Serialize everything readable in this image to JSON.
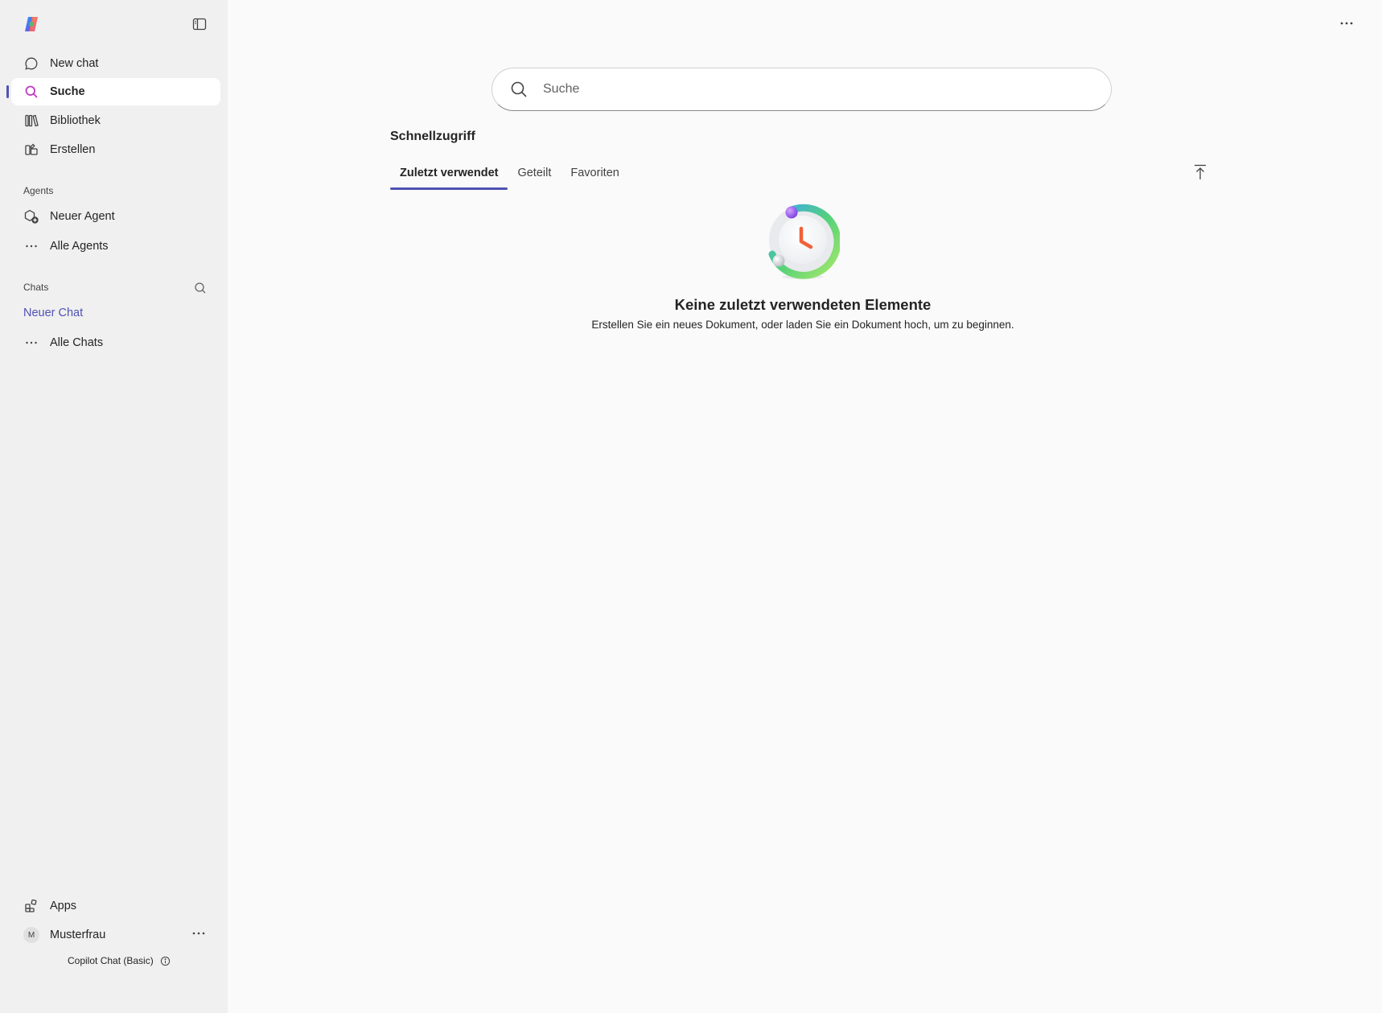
{
  "sidebar": {
    "nav": [
      {
        "label": "New chat",
        "icon": "chat-bubble-icon"
      },
      {
        "label": "Suche",
        "icon": "search-icon",
        "active": true
      },
      {
        "label": "Bibliothek",
        "icon": "library-icon"
      },
      {
        "label": "Erstellen",
        "icon": "create-icon"
      }
    ],
    "agents_label": "Agents",
    "agents": [
      {
        "label": "Neuer Agent",
        "icon": "new-agent-icon"
      },
      {
        "label": "Alle Agents",
        "icon": "more-dots-icon"
      }
    ],
    "chats_label": "Chats",
    "chats": {
      "new_chat": "Neuer Chat",
      "all_chats": "Alle Chats"
    },
    "apps_label": "Apps",
    "user": {
      "initial": "M",
      "name": "Musterfrau"
    },
    "plan": "Copilot Chat (Basic)"
  },
  "main": {
    "search_placeholder": "Suche",
    "quick_access_title": "Schnellzugriff",
    "tabs": [
      {
        "label": "Zuletzt verwendet",
        "active": true
      },
      {
        "label": "Geteilt"
      },
      {
        "label": "Favoriten"
      }
    ],
    "empty_title": "Keine zuletzt verwendeten Elemente",
    "empty_subtitle": "Erstellen Sie ein neues Dokument, oder laden Sie ein Dokument hoch, um zu beginnen."
  },
  "colors": {
    "accent": "#4f52b2",
    "search_active": "#c03bc4",
    "sidebar_bg": "#f0f0f0",
    "main_bg": "#fafafa"
  }
}
